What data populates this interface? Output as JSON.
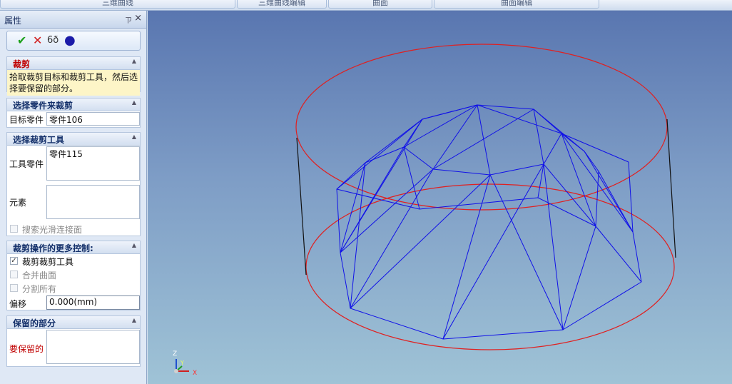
{
  "top_tabs": [
    "三维曲线",
    "三维曲线编辑",
    "曲面",
    "曲面编辑"
  ],
  "panel": {
    "title": "属性",
    "pin_glyph": "ㄗ",
    "close_glyph": "×"
  },
  "toolbar": {
    "icons": [
      "check-icon",
      "cross-icon",
      "preview-glasses-icon",
      "blue-dot-icon"
    ]
  },
  "groups": {
    "trim": {
      "title": "裁剪",
      "hint": "拾取裁剪目标和裁剪工具，然后选择要保留的部分。"
    },
    "select_parts": {
      "title": "选择零件来裁剪",
      "target_label": "目标零件",
      "target_value": "零件106"
    },
    "select_tools": {
      "title": "选择裁剪工具",
      "tool_label": "工具零件",
      "tool_value": "零件115",
      "element_label": "元素",
      "element_value": "",
      "search_smooth_label": "搜索光滑连接面"
    },
    "more_controls": {
      "title": "裁剪操作的更多控制:",
      "trim_tools_label": "裁剪裁剪工具",
      "trim_tools_checked": true,
      "merge_surfaces_label": "合并曲面",
      "split_all_label": "分割所有",
      "offset_label": "偏移",
      "offset_value": "0.000(mm)"
    },
    "keep_part": {
      "title": "保留的部分",
      "keep_label": "要保留的"
    }
  },
  "axes": {
    "z_label": "Z",
    "y_label": "Y",
    "x_label": "X"
  },
  "colors": {
    "ellipse": "#e02020",
    "wireframe": "#1010e8",
    "cylinder_edge": "#111111"
  }
}
